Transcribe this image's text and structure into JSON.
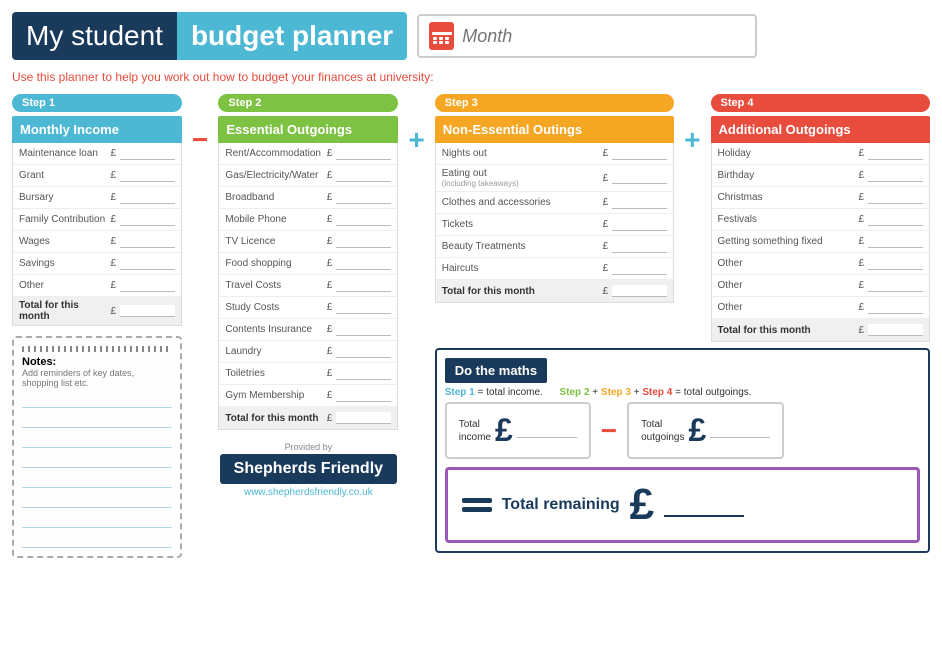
{
  "header": {
    "title_part1": "My student ",
    "title_part2": "budget planner",
    "month_placeholder": "Month"
  },
  "subtitle": "Use this planner to help you work out how to budget your finances at university:",
  "step1": {
    "label": "Step 1",
    "header": "Monthly Income",
    "rows": [
      {
        "label": "Maintenance loan",
        "currency": "£"
      },
      {
        "label": "Grant",
        "currency": "£"
      },
      {
        "label": "Bursary",
        "currency": "£"
      },
      {
        "label": "Family Contribution",
        "currency": "£"
      },
      {
        "label": "Wages",
        "currency": "£"
      },
      {
        "label": "Savings",
        "currency": "£"
      },
      {
        "label": "Other",
        "currency": "£"
      }
    ],
    "total_label": "Total for this month",
    "total_currency": "£"
  },
  "step2": {
    "label": "Step 2",
    "header": "Essential Outgoings",
    "rows": [
      {
        "label": "Rent/Accommodation",
        "currency": "£"
      },
      {
        "label": "Gas/Electricity/Water",
        "currency": "£"
      },
      {
        "label": "Broadband",
        "currency": "£"
      },
      {
        "label": "Mobile Phone",
        "currency": "£"
      },
      {
        "label": "TV Licence",
        "currency": "£"
      },
      {
        "label": "Food shopping",
        "currency": "£"
      },
      {
        "label": "Travel Costs",
        "currency": "£"
      },
      {
        "label": "Study Costs",
        "currency": "£"
      },
      {
        "label": "Contents Insurance",
        "currency": "£"
      },
      {
        "label": "Laundry",
        "currency": "£"
      },
      {
        "label": "Toiletries",
        "currency": "£"
      },
      {
        "label": "Gym Membership",
        "currency": "£"
      }
    ],
    "total_label": "Total for this month",
    "total_currency": "£"
  },
  "step3": {
    "label": "Step 3",
    "header": "Non-Essential Outings",
    "rows": [
      {
        "label": "Nights out",
        "currency": "£"
      },
      {
        "label": "Eating out",
        "sub": "(including takeaways)",
        "currency": "£"
      },
      {
        "label": "Clothes and accessories",
        "currency": "£"
      },
      {
        "label": "Tickets",
        "currency": "£"
      },
      {
        "label": "Beauty Treatments",
        "currency": "£"
      },
      {
        "label": "Haircuts",
        "currency": "£"
      }
    ],
    "total_label": "Total for this month",
    "total_currency": "£"
  },
  "step4": {
    "label": "Step 4",
    "header": "Additional Outgoings",
    "rows": [
      {
        "label": "Holiday",
        "currency": "£"
      },
      {
        "label": "Birthday",
        "currency": "£"
      },
      {
        "label": "Christmas",
        "currency": "£"
      },
      {
        "label": "Festivals",
        "currency": "£"
      },
      {
        "label": "Getting something fixed",
        "currency": "£"
      },
      {
        "label": "Other",
        "currency": "£"
      },
      {
        "label": "Other",
        "currency": "£"
      },
      {
        "label": "Other",
        "currency": "£"
      }
    ],
    "total_label": "Total for this month",
    "total_currency": "£"
  },
  "notes": {
    "title": "Notes:",
    "description": "Add reminders of key dates, shopping list etc."
  },
  "do_the_maths": {
    "header": "Do the maths",
    "step1_ref": "Step 1",
    "eq1": " = total income.",
    "step2_ref": "Step 2",
    "plus1": " + ",
    "step3_ref": "Step 3",
    "plus2": " + ",
    "step4_ref": "Step 4",
    "eq2": " = total outgoings.",
    "total_income_label": "Total\nincome",
    "total_income_currency": "£",
    "total_outgoings_label": "Total\noutgoings",
    "total_outgoings_currency": "£",
    "total_remaining_label": "Total\nremaining",
    "total_remaining_currency": "£"
  },
  "provided_by": {
    "text": "Provided by",
    "brand": "Shepherds Friendly",
    "website": "www.shepherdsfriendly.co.uk"
  }
}
